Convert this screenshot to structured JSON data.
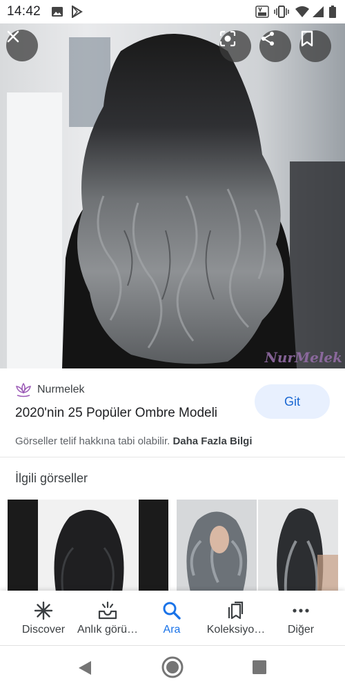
{
  "status_bar": {
    "time": "14:42",
    "left_icons": [
      "photo-icon",
      "play-store-icon"
    ],
    "right_icons": [
      "volte-icon",
      "vibrate-icon",
      "wifi-icon",
      "signal-icon",
      "battery-icon"
    ]
  },
  "viewer": {
    "close_icon": "close-icon",
    "lens_icon": "lens-icon",
    "share_icon": "share-icon",
    "bookmark_icon": "bookmark-icon",
    "watermark": "NurMelek"
  },
  "result": {
    "source_name": "Nurmelek",
    "title": "2020'nin 25 Popüler Ombre Modeli",
    "visit_button": "Git",
    "copyright_notice": "Görseller telif hakkına tabi olabilir.",
    "more_info_link": "Daha Fazla Bilgi"
  },
  "related": {
    "heading": "İlgili görseller"
  },
  "bottom_nav": {
    "items": [
      {
        "label": "Discover",
        "icon": "asterisk-icon",
        "active": false
      },
      {
        "label": "Anlık görü…",
        "icon": "updates-tray-icon",
        "active": false
      },
      {
        "label": "Ara",
        "icon": "search-icon",
        "active": true
      },
      {
        "label": "Koleksiyo…",
        "icon": "collections-icon",
        "active": false
      },
      {
        "label": "Diğer",
        "icon": "more-dots-icon",
        "active": false
      }
    ],
    "active_color": "#1a73e8"
  },
  "system_nav": {
    "icons": [
      "back-icon",
      "home-icon",
      "recents-icon"
    ]
  }
}
